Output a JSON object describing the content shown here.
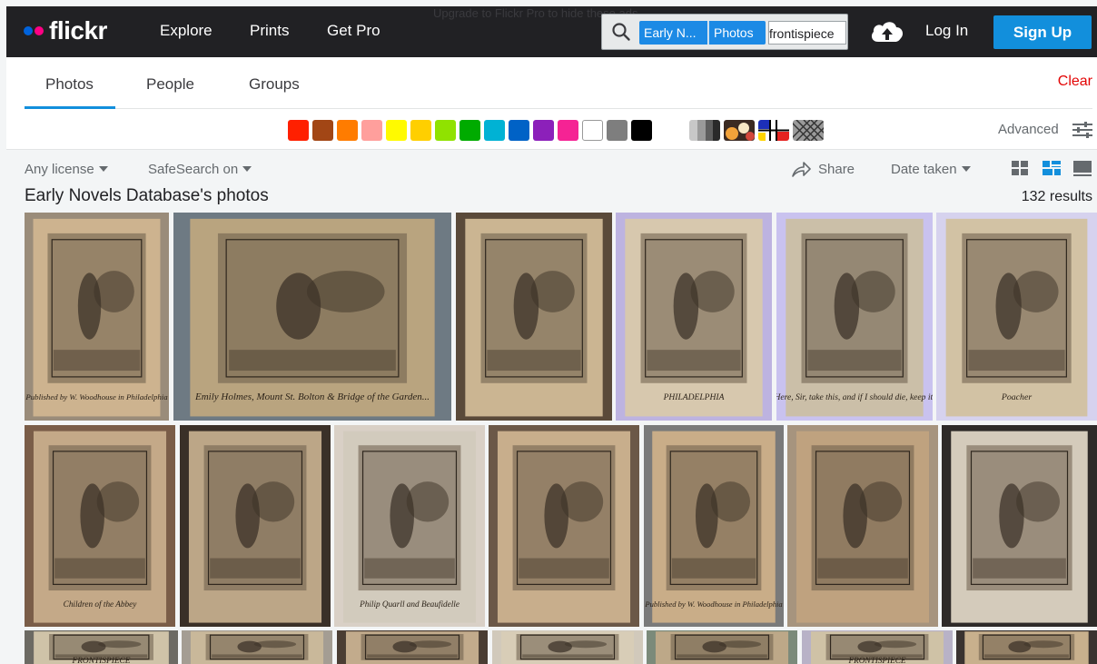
{
  "topbar": {
    "logo_text": "flickr",
    "ghost_text": "Upgrade to Flickr Pro to hide these ads",
    "nav": [
      "Explore",
      "Prints",
      "Get Pro"
    ],
    "search": {
      "chip_group": "Early N...",
      "chip_type": "Photos",
      "query": "frontispiece"
    },
    "login_label": "Log In",
    "signup_label": "Sign Up"
  },
  "tabs": [
    "Photos",
    "People",
    "Groups"
  ],
  "active_tab": "Photos",
  "clear_label": "Clear",
  "color_swatches": [
    "#ff2000",
    "#a24615",
    "#ff7c00",
    "#ff9f9c",
    "#fffa00",
    "#ffcf00",
    "#90e200",
    "#00ab00",
    "#00b2d4",
    "#0062c6",
    "#8c20ba",
    "#f52394",
    "#ffffff",
    "#7e7e7e",
    "#000000"
  ],
  "style_filters": [
    "black-and-white",
    "shallow-depth-of-field",
    "minimalist",
    "patterns"
  ],
  "advanced_label": "Advanced",
  "toolbar": {
    "license_label": "Any license",
    "safesearch_label": "SafeSearch on",
    "share_label": "Share",
    "sort_label": "Date taken"
  },
  "heading": "Early Novels Database's photos",
  "results_label": "132 results",
  "colors": {
    "topbar_bg": "#212124",
    "accent_blue": "#128fdc",
    "clear_red": "#e30505"
  },
  "photos": [
    {
      "name": "photo-man-with-umbrella",
      "caption": "Published by W. Woodhouse in Philadelphia"
    },
    {
      "name": "photo-emily-hobson-print",
      "caption": "Emily Holmes, Mount St. Bolton & Bridge of the Garden..."
    },
    {
      "name": "photo-tropical-scene",
      "caption": ""
    },
    {
      "name": "photo-philadelphia-title",
      "caption": "PHILADELPHIA"
    },
    {
      "name": "photo-bedroom-scene",
      "caption": "Here, Sir, take this, and if I should die, keep it."
    },
    {
      "name": "photo-poacher-scene",
      "caption": "Poacher"
    },
    {
      "name": "photo-children-of-the-abbey",
      "caption": "Children of the Abbey"
    },
    {
      "name": "photo-reclining-figure",
      "caption": ""
    },
    {
      "name": "photo-philip-quarll",
      "caption": "Philip Quarll and Beaufidelle"
    },
    {
      "name": "photo-bedside-scene",
      "caption": ""
    },
    {
      "name": "photo-man-with-umbrella-2",
      "caption": "Published by W. Woodhouse in Philadelphia"
    },
    {
      "name": "photo-cave-scene",
      "caption": ""
    },
    {
      "name": "photo-landscape-print",
      "caption": ""
    },
    {
      "name": "photo-frontispiece-1",
      "caption": "FRONTISPIECE"
    },
    {
      "name": "photo-row3-2",
      "caption": ""
    },
    {
      "name": "photo-row3-3",
      "caption": ""
    },
    {
      "name": "photo-row3-4",
      "caption": ""
    },
    {
      "name": "photo-row3-5",
      "caption": ""
    },
    {
      "name": "photo-frontispiece-2",
      "caption": "FRONTISPIECE"
    },
    {
      "name": "photo-row3-7",
      "caption": ""
    }
  ]
}
